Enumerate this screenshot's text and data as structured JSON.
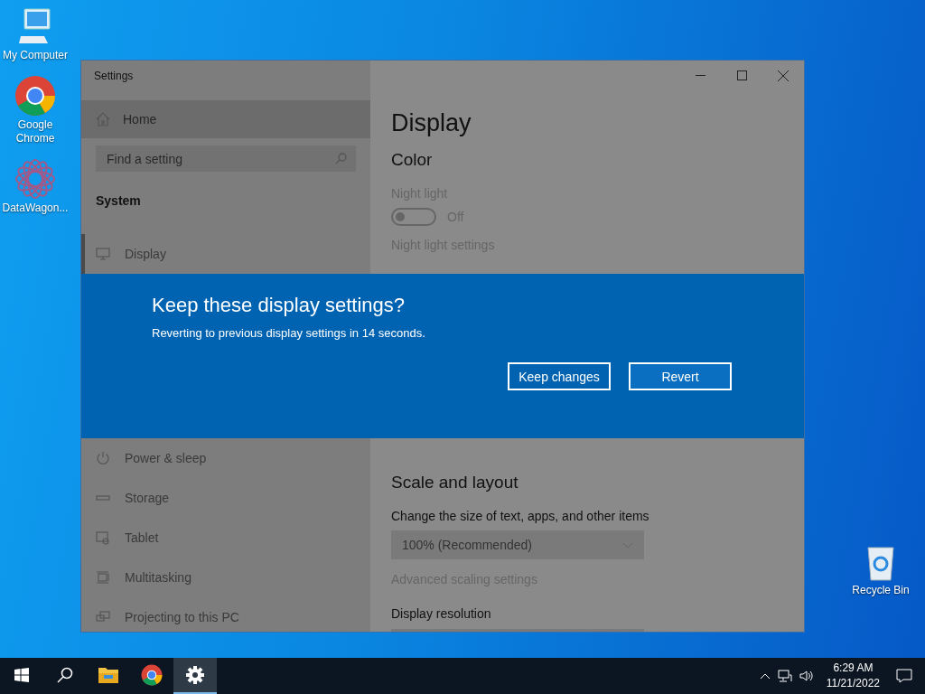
{
  "desktop_icons": [
    {
      "label": "My Computer",
      "kind": "computer"
    },
    {
      "label": "Google Chrome",
      "kind": "chrome"
    },
    {
      "label": "DataWagon...",
      "kind": "datawagon"
    }
  ],
  "recycle_bin": {
    "label": "Recycle Bin"
  },
  "window": {
    "title": "Settings",
    "sidebar": {
      "home": {
        "label": "Home",
        "highlighted": true
      },
      "search": {
        "placeholder": "Find a setting"
      },
      "section": "System",
      "items_top": [
        {
          "label": "Display",
          "kind": "display",
          "selected": true
        }
      ],
      "items_bottom": [
        {
          "label": "Power & sleep",
          "kind": "power",
          "selected": false
        },
        {
          "label": "Storage",
          "kind": "storage",
          "selected": false
        },
        {
          "label": "Tablet",
          "kind": "tablet",
          "selected": false
        },
        {
          "label": "Multitasking",
          "kind": "multitasking",
          "selected": false
        },
        {
          "label": "Projecting to this PC",
          "kind": "projecting",
          "selected": false
        }
      ]
    },
    "content": {
      "page_title": "Display",
      "color_heading": "Color",
      "night_light": {
        "label": "Night light",
        "on": false,
        "state_label": "Off"
      },
      "night_light_link": "Night light settings",
      "scale_heading": "Scale and layout",
      "scale_label": "Change the size of text, apps, and other items",
      "scale_value": "100% (Recommended)",
      "scale_link": "Advanced scaling settings",
      "resolution_label": "Display resolution"
    }
  },
  "dialog": {
    "title": "Keep these display settings?",
    "message": "Reverting to previous display settings in 14 seconds.",
    "buttons": [
      {
        "label": "Keep changes",
        "kind": "secondary"
      },
      {
        "label": "Revert",
        "kind": "primary"
      }
    ]
  },
  "taskbar": {
    "apps": [
      {
        "kind": "start",
        "active": false
      },
      {
        "kind": "search",
        "active": false
      },
      {
        "kind": "explorer",
        "active": false
      },
      {
        "kind": "chrome",
        "active": false
      },
      {
        "kind": "settings",
        "active": true
      }
    ],
    "time": "6:29 AM",
    "date": "11/21/2022"
  }
}
